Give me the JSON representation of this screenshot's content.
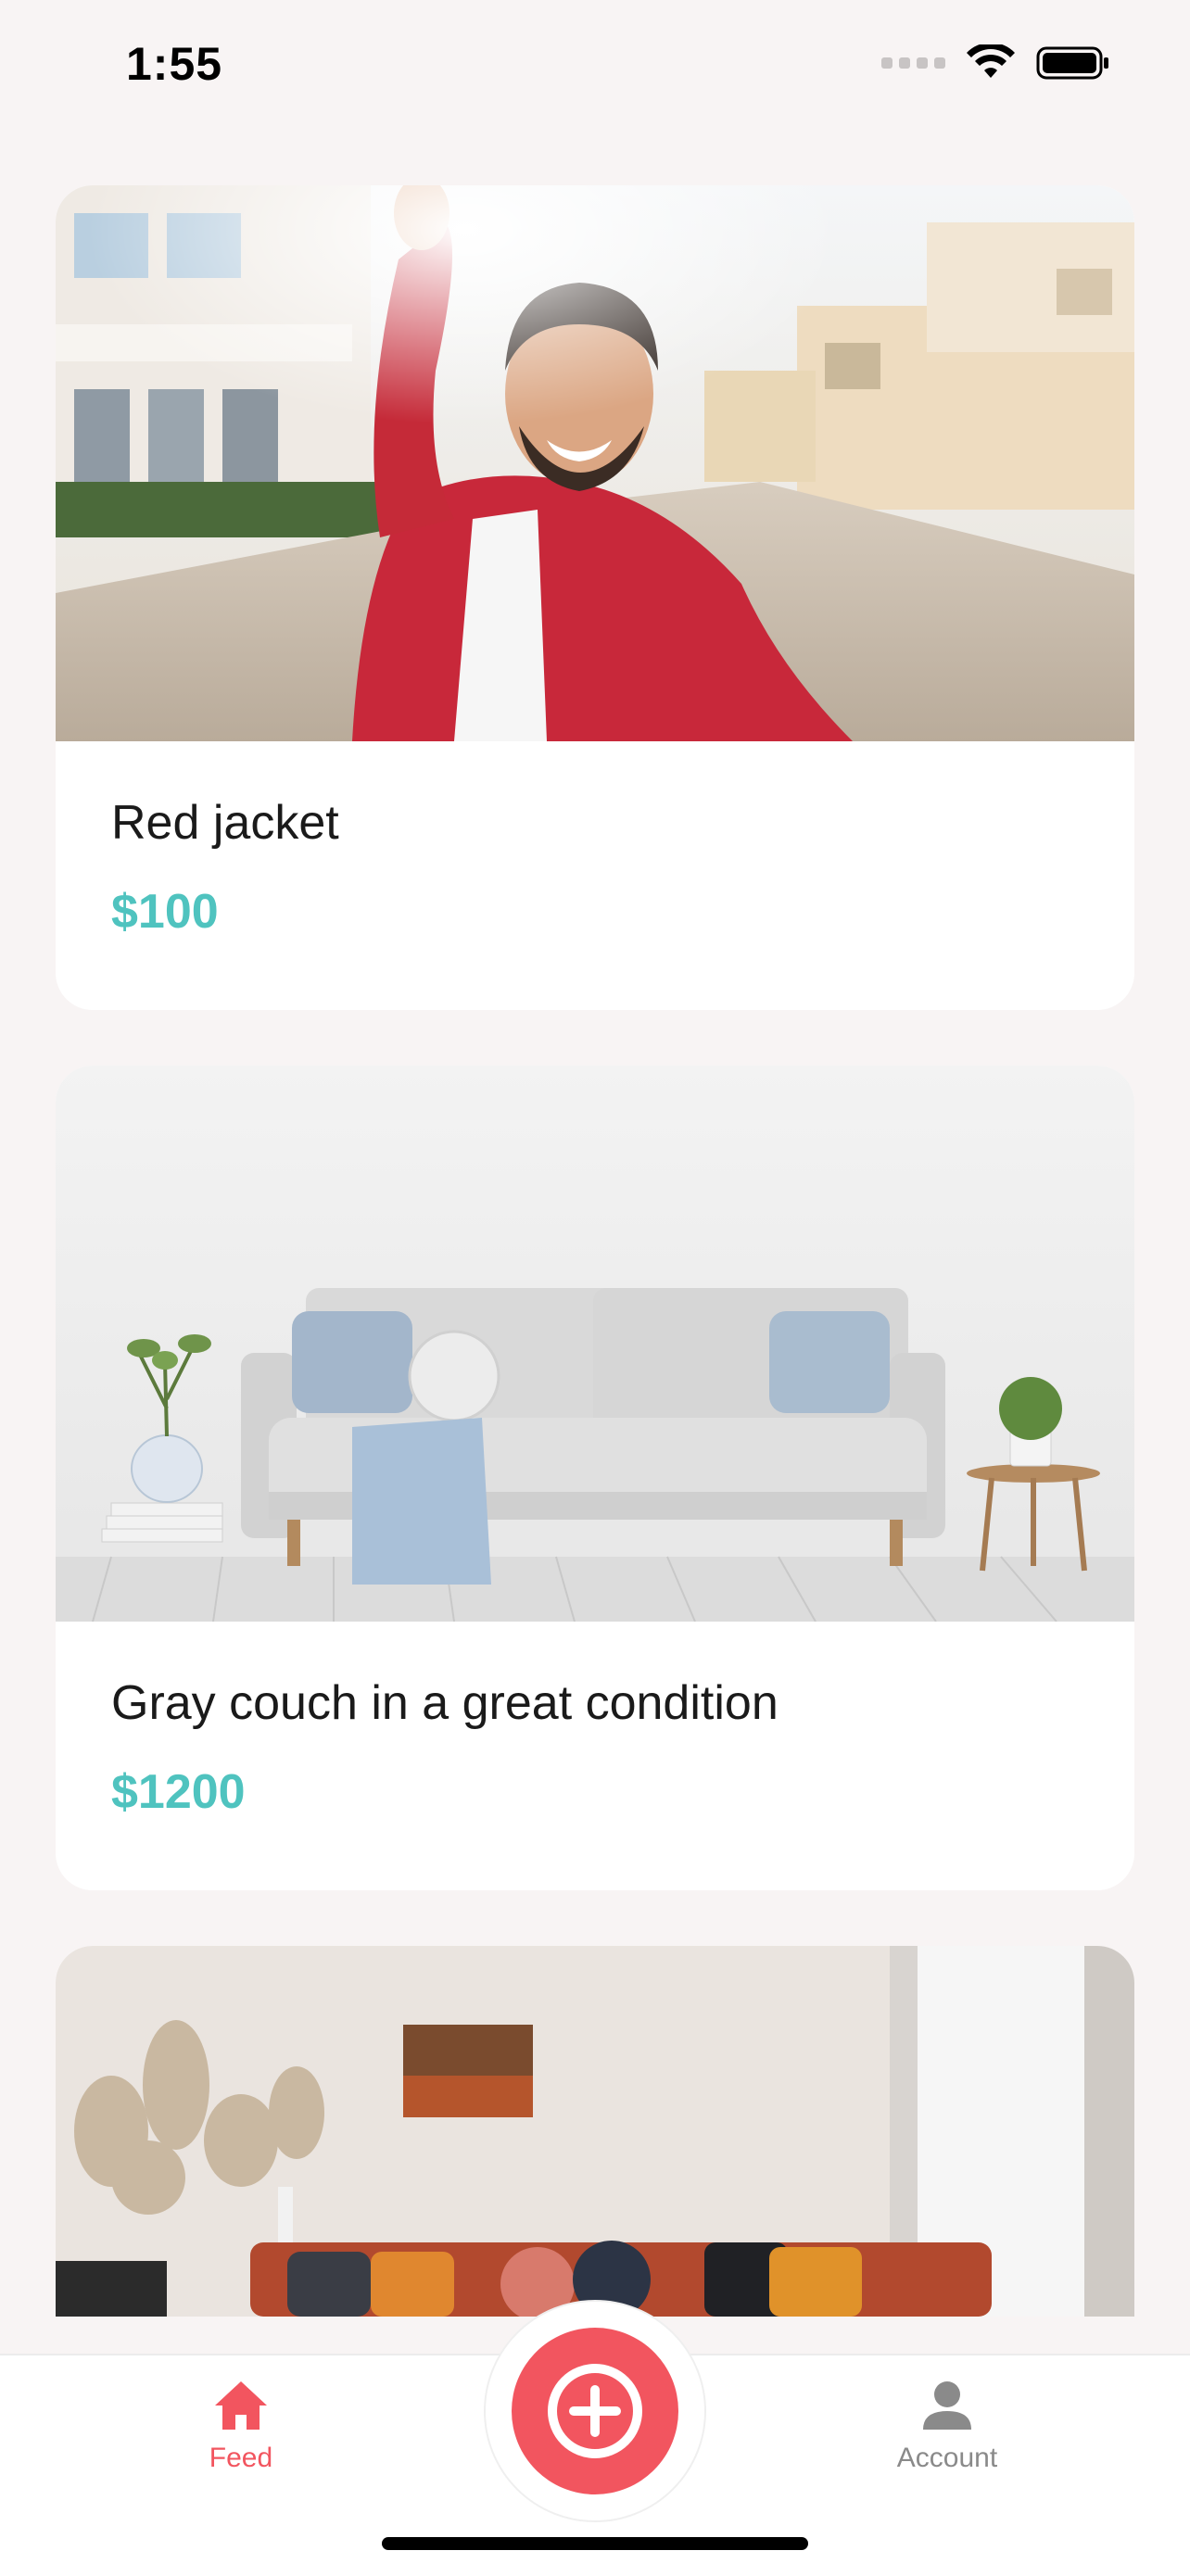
{
  "status_bar": {
    "time": "1:55",
    "icons": [
      "cellular-signal-icon",
      "wifi-icon",
      "battery-icon"
    ]
  },
  "feed": {
    "items": [
      {
        "title": "Red jacket",
        "price": "$100",
        "image": "photo-man-red-jacket"
      },
      {
        "title": "Gray couch in a great condition",
        "price": "$1200",
        "image": "photo-gray-couch"
      },
      {
        "title": "",
        "price": "",
        "image": "photo-orange-couch-living-room"
      }
    ]
  },
  "tab_bar": {
    "feed_label": "Feed",
    "account_label": "Account",
    "active_tab": "Feed",
    "fab_icon": "plus-icon"
  },
  "colors": {
    "accent": "#f2555f",
    "price": "#4fc3bf",
    "background": "#f8f4f4",
    "inactive_tab": "#8a8a8a"
  }
}
